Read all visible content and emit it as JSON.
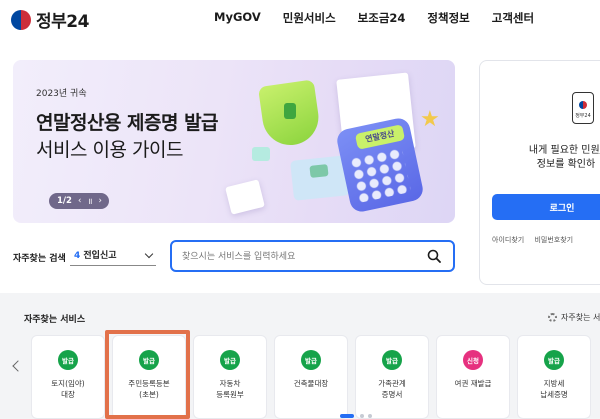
{
  "header": {
    "logo_text": "정부24",
    "nav": [
      "MyGOV",
      "민원서비스",
      "보조금24",
      "정책정보",
      "고객센터"
    ]
  },
  "hero": {
    "year": "2023년 귀속",
    "title": "연말정산용 제증명 발급",
    "subtitle": "서비스 이용 가이드",
    "pager": "1/2",
    "pager_prev": "‹",
    "pager_pause": "॥",
    "pager_next": "›",
    "calc_label": "연말정산"
  },
  "login": {
    "app_label": "정부24",
    "message_line1": "내게 필요한 민원/",
    "message_line2": "정보를 확인하",
    "button": "로그인",
    "link_id": "아이디찾기",
    "link_pw": "비밀번호찾기"
  },
  "quick_search": {
    "label": "자주찾는 검색",
    "select_num": "4",
    "select_text": "전입신고",
    "placeholder": "찾으시는 서비스를 입력하세요"
  },
  "services": {
    "title": "자주찾는 서비스",
    "settings": "자주찾는 서비",
    "cards": [
      {
        "badge": "발급",
        "color": "green",
        "line1": "토지(임야)",
        "line2": "대장"
      },
      {
        "badge": "발급",
        "color": "green",
        "line1": "주민등록등본",
        "line2": "(초본)"
      },
      {
        "badge": "발급",
        "color": "green",
        "line1": "자동차",
        "line2": "등록원부"
      },
      {
        "badge": "발급",
        "color": "green",
        "line1": "건축물대장",
        "line2": ""
      },
      {
        "badge": "발급",
        "color": "green",
        "line1": "가족관계",
        "line2": "증명서"
      },
      {
        "badge": "신청",
        "color": "pink",
        "line1": "여권 재발급",
        "line2": ""
      },
      {
        "badge": "발급",
        "color": "green",
        "line1": "지방세",
        "line2": "납세증명"
      }
    ]
  },
  "colors": {
    "primary": "#256ef4",
    "issue_badge": "#16a34a",
    "apply_badge": "#e6317f",
    "highlight": "#e2714a"
  }
}
